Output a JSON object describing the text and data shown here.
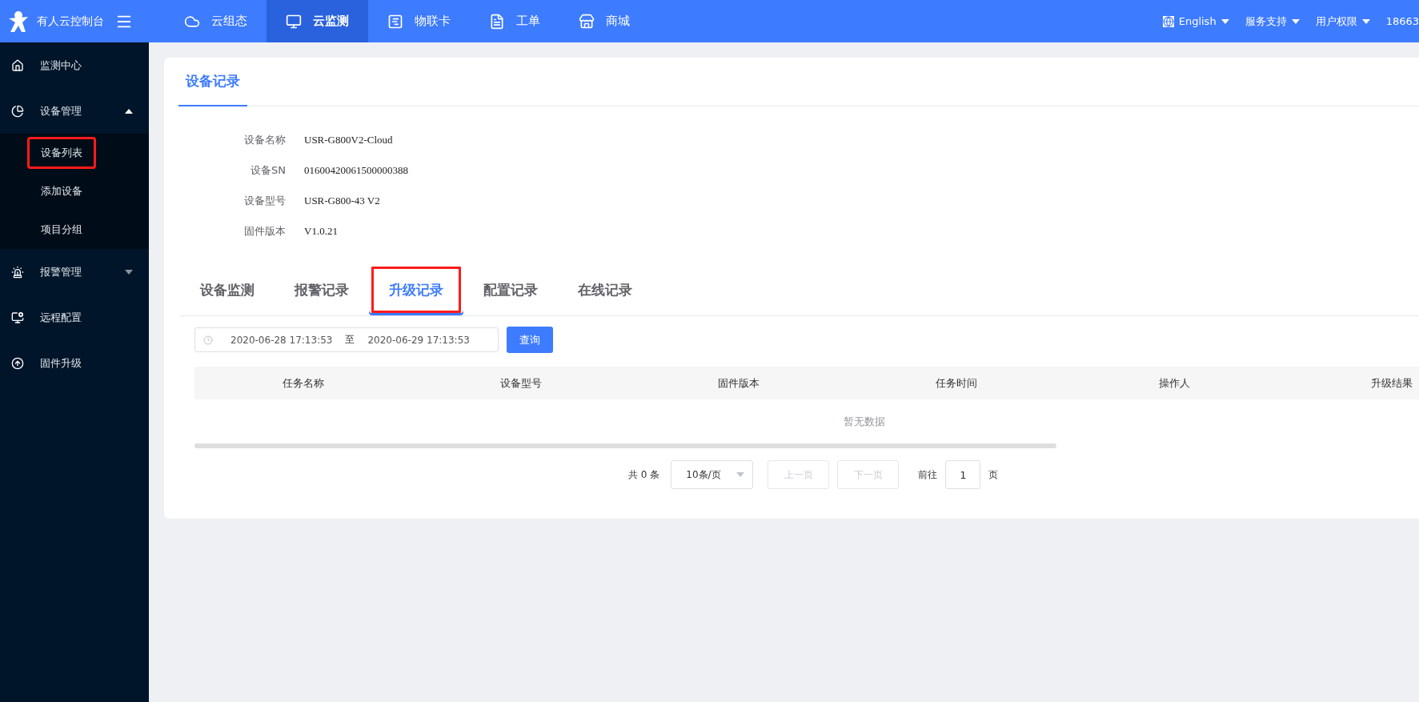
{
  "brand": {
    "title": "有人云控制台"
  },
  "top_nav": [
    {
      "label": "云组态",
      "selected": false
    },
    {
      "label": "云监测",
      "selected": true
    },
    {
      "label": "物联卡",
      "selected": false
    },
    {
      "label": "工单",
      "selected": false
    },
    {
      "label": "商城",
      "selected": false
    }
  ],
  "top_right": {
    "language": "English",
    "menus": [
      "服务支持",
      "用户权限"
    ],
    "user": "18663"
  },
  "sidebar": {
    "items": [
      {
        "label": "监测中心"
      },
      {
        "label": "设备管理",
        "expanded": true,
        "children": [
          {
            "label": "设备列表",
            "highlighted": true
          },
          {
            "label": "添加设备",
            "highlighted": false
          },
          {
            "label": "项目分组",
            "highlighted": false
          }
        ]
      },
      {
        "label": "报警管理",
        "expanded": false
      },
      {
        "label": "远程配置"
      },
      {
        "label": "固件升级"
      }
    ]
  },
  "page_tab": "设备记录",
  "device_info": [
    {
      "label": "设备名称",
      "value": "USR-G800V2-Cloud"
    },
    {
      "label": "设备SN",
      "value": "01600420061500000388"
    },
    {
      "label": "设备型号",
      "value": "USR-G800-43 V2"
    },
    {
      "label": "固件版本",
      "value": "V1.0.21"
    }
  ],
  "record_tabs": [
    {
      "label": "设备监测",
      "selected": false,
      "highlighted": false
    },
    {
      "label": "报警记录",
      "selected": false,
      "highlighted": false
    },
    {
      "label": "升级记录",
      "selected": true,
      "highlighted": true
    },
    {
      "label": "配置记录",
      "selected": false,
      "highlighted": false
    },
    {
      "label": "在线记录",
      "selected": false,
      "highlighted": false
    }
  ],
  "date_range": {
    "start": "2020-06-28 17:13:53",
    "separator": "至",
    "end": "2020-06-29 17:13:53"
  },
  "query_button": "查询",
  "table": {
    "columns": [
      "任务名称",
      "设备型号",
      "固件版本",
      "任务时间",
      "操作人",
      "升级结果"
    ],
    "empty_text": "暂无数据"
  },
  "pagination": {
    "total": "共 0 条",
    "page_size": "10条/页",
    "prev": {
      "label": "上一页",
      "disabled": true
    },
    "next": {
      "label": "下一页",
      "disabled": true
    },
    "goto": "前往",
    "page": "1",
    "page_unit": "页"
  }
}
